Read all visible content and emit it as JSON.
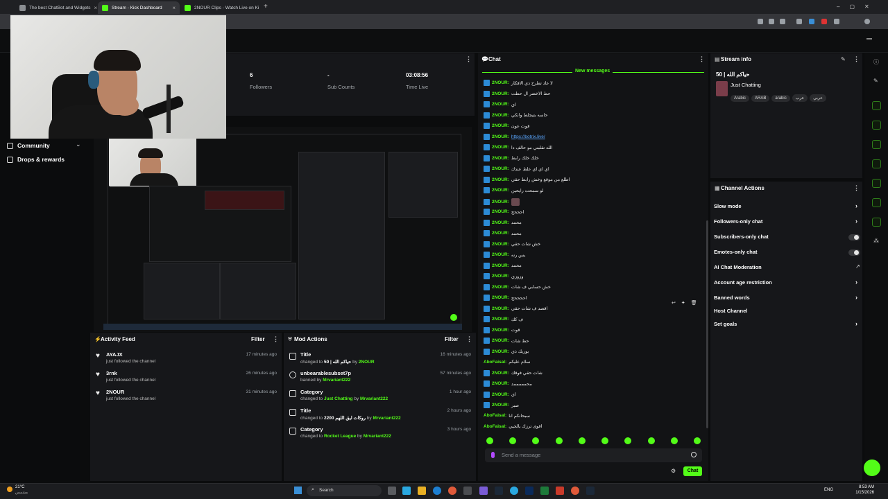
{
  "browser": {
    "tabs": [
      {
        "label": "The best ChatBot and Widgets",
        "color": "#8a8d91"
      },
      {
        "label": "Stream - Kick Dashboard",
        "color": "#53fc18"
      },
      {
        "label": "2NOUR Clips - Watch Live on Ki",
        "color": "#53fc18"
      }
    ],
    "new_tab": "+"
  },
  "nav": {
    "community": "Community",
    "drops": "Drops & rewards"
  },
  "stats": {
    "followers_value": "6",
    "followers_label": "Followers",
    "subs_value": "-",
    "subs_label": "Sub Counts",
    "time_value": "03:08:56",
    "time_label": "Time Live"
  },
  "activity_feed": {
    "title": "Activity Feed",
    "filter": "Filter",
    "items": [
      {
        "name": "AYAJX",
        "sub": "just followed the channel",
        "time": "17 minutes ago"
      },
      {
        "name": "3rnk",
        "sub": "just followed the channel",
        "time": "26 minutes ago"
      },
      {
        "name": "2NOUR",
        "sub": "just followed the channel",
        "time": "31 minutes ago"
      }
    ]
  },
  "mod_actions": {
    "title": "Mod Actions",
    "filter": "Filter",
    "items": [
      {
        "title": "Title",
        "pre": "changed to",
        "value": "50 | حياكم الله",
        "by": "by",
        "user": "2NOUR",
        "time": "16 minutes ago"
      },
      {
        "title": "unbearablesubset7p",
        "pre": "banned by",
        "value": "",
        "by": "",
        "user": "Mrvariant222",
        "time": "57 minutes ago"
      },
      {
        "title": "Category",
        "pre": "changed to",
        "value": "Just Chatting",
        "by": "by",
        "user": "Mrvariant222",
        "time": "1 hour ago"
      },
      {
        "title": "Title",
        "pre": "changed to",
        "value": "2200 روكات ليق اللهم",
        "by": "by",
        "user": "Mrvariant222",
        "time": "2 hours ago"
      },
      {
        "title": "Category",
        "pre": "changed to",
        "value": "Rocket League",
        "by": "by",
        "user": "Mrvariant222",
        "time": "3 hours ago"
      }
    ]
  },
  "chat": {
    "title": "Chat",
    "new_messages": "New messages",
    "messages": [
      {
        "user": "2NOUR:",
        "text": "لا عاد تطرح ذي الافكار",
        "badge": true
      },
      {
        "user": "2NOUR:",
        "text": "حط الاخضر ال حطت",
        "badge": true
      },
      {
        "user": "2NOUR:",
        "text": "اي",
        "badge": true
      },
      {
        "user": "2NOUR:",
        "text": "حاسه بتيجلط وانكي",
        "badge": true
      },
      {
        "user": "2NOUR:",
        "text": "قوت عون",
        "badge": true
      },
      {
        "user": "2NOUR:",
        "text": "https://botrix.live/",
        "badge": true,
        "link": true
      },
      {
        "user": "2NOUR:",
        "text": "الله تقلبني مو حالف دا",
        "badge": true
      },
      {
        "user": "2NOUR:",
        "text": "خلك خلك رابط",
        "badge": true
      },
      {
        "user": "2NOUR:",
        "text": "اي اي اي علط عندك",
        "badge": true
      },
      {
        "user": "2NOUR:",
        "text": "اطلع من موقع وخش رابط حقي",
        "badge": true
      },
      {
        "user": "2NOUR:",
        "text": "لو سمحت رايحين",
        "badge": true
      },
      {
        "user": "2NOUR:",
        "text": "",
        "badge": true,
        "image": true
      },
      {
        "user": "2NOUR:",
        "text": "احححح",
        "badge": true
      },
      {
        "user": "2NOUR:",
        "text": "محمد",
        "badge": true
      },
      {
        "user": "2NOUR:",
        "text": "محمد",
        "badge": true
      },
      {
        "user": "2NOUR:",
        "text": "خش شات حقي",
        "badge": true
      },
      {
        "user": "2NOUR:",
        "text": "يس رنه",
        "badge": true
      },
      {
        "user": "2NOUR:",
        "text": "محمد",
        "badge": true
      },
      {
        "user": "2NOUR:",
        "text": "وزوزي",
        "badge": true
      },
      {
        "user": "2NOUR:",
        "text": "خش حسابي ف شات",
        "badge": true
      },
      {
        "user": "2NOUR:",
        "text": "اححححح",
        "badge": true
      },
      {
        "user": "2NOUR:",
        "text": "اقصد ف شات حقي",
        "badge": true
      },
      {
        "user": "2NOUR:",
        "text": "ف كك",
        "badge": true
      },
      {
        "user": "2NOUR:",
        "text": "قوت",
        "badge": true
      },
      {
        "user": "2NOUR:",
        "text": "حط شات",
        "badge": true
      },
      {
        "user": "2NOUR:",
        "text": "بوريك ذي",
        "badge": true
      },
      {
        "user": "AboFaisal:",
        "text": "سلام عليكم",
        "badge": false
      },
      {
        "user": "2NOUR:",
        "text": "شات حقي فوقك",
        "badge": true
      },
      {
        "user": "2NOUR:",
        "text": "محمممممد",
        "badge": true
      },
      {
        "user": "2NOUR:",
        "text": "اي",
        "badge": true
      },
      {
        "user": "2NOUR:",
        "text": "صبر",
        "badge": true
      },
      {
        "user": "AboFaisal:",
        "text": "سبحانكم انا",
        "badge": false
      },
      {
        "user": "AboFaisal:",
        "text": "اقوى ترزك بالحيي",
        "badge": false
      }
    ],
    "input_placeholder": "Send a message",
    "send_label": "Chat"
  },
  "stream_info": {
    "title": "Stream info",
    "stream_title": "50 | حياكم الله",
    "category": "Just Chatting",
    "tags": [
      "Arabic",
      "ARAB",
      "arabic",
      "عرب",
      "عربي"
    ]
  },
  "channel_actions": {
    "title": "Channel Actions",
    "items": [
      {
        "label": "Slow mode",
        "control": "chevron"
      },
      {
        "label": "Followers-only chat",
        "control": "chevron"
      },
      {
        "label": "Subscribers-only chat",
        "control": "toggle"
      },
      {
        "label": "Emotes-only chat",
        "control": "toggle"
      },
      {
        "label": "AI Chat Moderation",
        "control": "external"
      },
      {
        "label": "Account age restriction",
        "control": "chevron"
      },
      {
        "label": "Banned words",
        "control": "chevron"
      },
      {
        "label": "Host Channel",
        "control": "none"
      },
      {
        "label": "Set goals",
        "control": "chevron"
      }
    ]
  },
  "taskbar": {
    "weather": "21°C",
    "weather_sub": "مشمس",
    "search": "Search",
    "lang": "ENG",
    "time": "8:53 AM",
    "date": "1/15/2026"
  },
  "colors": {
    "accent": "#53fc18",
    "panel": "#16171a",
    "background": "#0b0c0d"
  }
}
